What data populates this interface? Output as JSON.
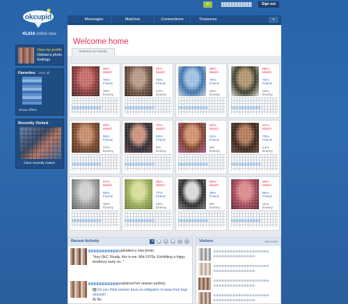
{
  "logo": {
    "text": "okcupid"
  },
  "online": {
    "count": "45,616",
    "label": "online now"
  },
  "profile_links": [
    "View my profile",
    "Upload a photo",
    "Settings"
  ],
  "favorites": {
    "title": "Favorites",
    "view_all": "View all",
    "offline": "Show offline"
  },
  "recently_visited": {
    "title": "Recently Visited",
    "clear": "Clear recently visited"
  },
  "topbar": {
    "signout": "Sign out"
  },
  "nav": {
    "items": [
      "Messages",
      "Matches",
      "Connections",
      "Treasures"
    ],
    "search_icon": "search-icon"
  },
  "welcome": "Welcome home",
  "tab": "Matches & Activity",
  "match_labels": {
    "match": "Match",
    "friend": "Friend",
    "enemy": "Enemy"
  },
  "matches": [
    {
      "match": "95%",
      "friend": "76%",
      "enemy": "19%",
      "colors": [
        "#8c3b3b",
        "#c56a6a",
        "#3d2c2c"
      ]
    },
    {
      "match": "92%",
      "friend": "75%",
      "enemy": "21%",
      "colors": [
        "#6e5346",
        "#b59a85",
        "#3b2a22"
      ]
    },
    {
      "match": "95%",
      "friend": "70%",
      "enemy": "26%",
      "colors": [
        "#3d6ea5",
        "#9ec0e2",
        "#c7d8ea"
      ]
    },
    {
      "match": "86%",
      "friend": "73%",
      "enemy": "15%",
      "colors": [
        "#3a3a2a",
        "#b09470",
        "#e7e2da"
      ]
    },
    {
      "match": "92%",
      "friend": "59%",
      "enemy": "27%",
      "colors": [
        "#7a4a2e",
        "#c48b68",
        "#4e2e1e"
      ]
    },
    {
      "match": "70%",
      "friend": "69%",
      "enemy": "9%",
      "colors": [
        "#2c2a36",
        "#c9907a",
        "#5c3d35"
      ]
    },
    {
      "match": "92%",
      "friend": "91%",
      "enemy": "0%",
      "colors": [
        "#7a3f2a",
        "#d09070",
        "#a55a9a"
      ]
    },
    {
      "match": "91%",
      "friend": "78%",
      "enemy": "13%",
      "colors": [
        "#3a241a",
        "#b07a5a",
        "#6a4a3a"
      ]
    },
    {
      "match": "67%",
      "friend": "58%",
      "enemy": "32%",
      "colors": [
        "#9a9a9a",
        "#cfcfcf",
        "#5a5a5a"
      ]
    },
    {
      "match": "86%",
      "friend": "77%",
      "enemy": "22%",
      "colors": [
        "#9aae5a",
        "#d6dc9a",
        "#6e7a3a"
      ]
    },
    {
      "match": "89%",
      "friend": "85%",
      "enemy": "9%",
      "colors": [
        "#2a2a2a",
        "#d8d8d8",
        "#7a7a7a"
      ]
    },
    {
      "match": "86%",
      "friend": "86%",
      "enemy": "11%",
      "colors": [
        "#a34a5a",
        "#d98a8a",
        "#5a2a3a"
      ]
    }
  ],
  "activity": {
    "title": "Recent Activity",
    "items": [
      {
        "action": "uploaded a new photo",
        "quote": "\"Hey OkC: Really, this is me. Mid-1970s. Exhibiting a hippy tendency early on. \""
      },
      {
        "action": "explained her answer publicly",
        "q_label": "Q)",
        "question": "Do you think women have an obligation to keep their legs shaved?",
        "answer": "A) No"
      }
    ]
  },
  "visitors": {
    "title": "Visitors",
    "more": "see more"
  }
}
